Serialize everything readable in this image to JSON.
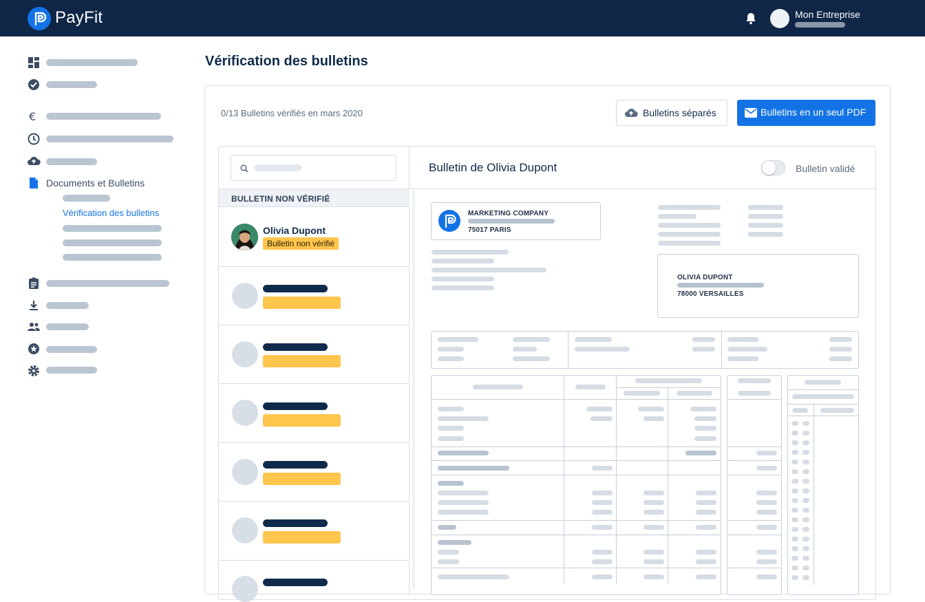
{
  "app": {
    "name": "PayFit"
  },
  "header": {
    "company_name": "Mon Entreprise"
  },
  "sidebar": {
    "documents_label": "Documents et Bulletins",
    "active_sub_label": "Vérification des bulletins"
  },
  "main": {
    "page_title": "Vérification des bulletins",
    "status_count": "0/13 Bulletins vérifiés en mars 2020",
    "btn_separate": "Bulletins séparés",
    "btn_single_pdf": "Bulletins en un seul PDF",
    "filter_label": "BULLETIN NON VÉRIFIÉ",
    "selected_employee": {
      "name": "Olivia Dupont",
      "status": "Bulletin non vérifié"
    },
    "detail_title": "Bulletin de Olivia Dupont",
    "toggle_label": "Bulletin validé",
    "toggle_on": false
  },
  "payslip": {
    "employer_name": "MARKETING COMPANY",
    "employer_city": "75017 PARIS",
    "employee_name": "OLIVIA DUPONT",
    "employee_city": "78000 VERSAILLES"
  },
  "colors": {
    "brand_navy": "#0f2647",
    "accent_blue": "#1373e6",
    "warning_yellow": "#ffc54d"
  },
  "icons": [
    "bell-icon",
    "dashboard-icon",
    "check-circle-icon",
    "euro-icon",
    "clock-icon",
    "cloud-upload-icon",
    "document-icon",
    "clipboard-icon",
    "download-icon",
    "people-icon",
    "star-icon",
    "gear-icon",
    "search-icon",
    "mail-icon",
    "chevron-down-icon"
  ]
}
